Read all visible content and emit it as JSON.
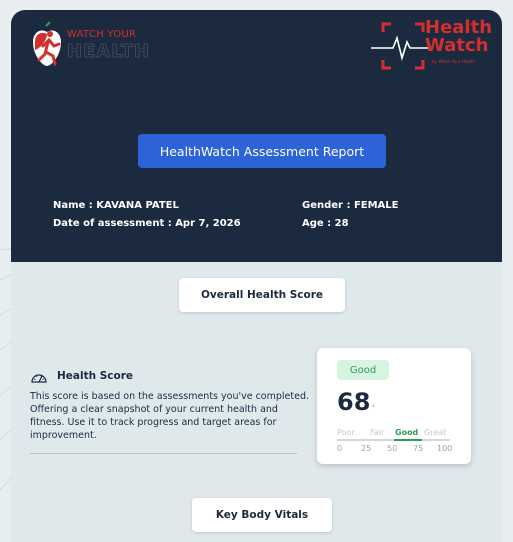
{
  "brand": {
    "left_line1": "WATCH YOUR",
    "left_line2": "HEALTH",
    "right_line1": "Health",
    "right_line2": "Watch",
    "right_tagline": "by Watch Your Health"
  },
  "report_title": "HealthWatch Assessment Report",
  "patient": {
    "name": "Name : KAVANA PATEL",
    "date": "Date of assessment : Apr 7, 2026",
    "gender": "Gender : FEMALE",
    "age": "Age : 28"
  },
  "sections": {
    "overall": "Overall Health Score",
    "vitals": "Key Body Vitals"
  },
  "health_score": {
    "title": "Health Score",
    "description": "This score is based on the assessments you've completed. Offering a clear snapshot of your current health and fitness. Use it to track progress and target areas for improvement.",
    "badge": "Good",
    "score": "68",
    "score_fraction": 0.68,
    "scale": [
      "Poor",
      "Fair",
      "Good",
      "Great"
    ],
    "ticks": [
      "0",
      "25",
      "50",
      "75",
      "100"
    ],
    "highlight_band": "Good"
  },
  "colors": {
    "header": "#1c2a40",
    "accent_blue": "#2c63d6",
    "brand_red": "#d32f2f",
    "good_green": "#2e9e58"
  }
}
